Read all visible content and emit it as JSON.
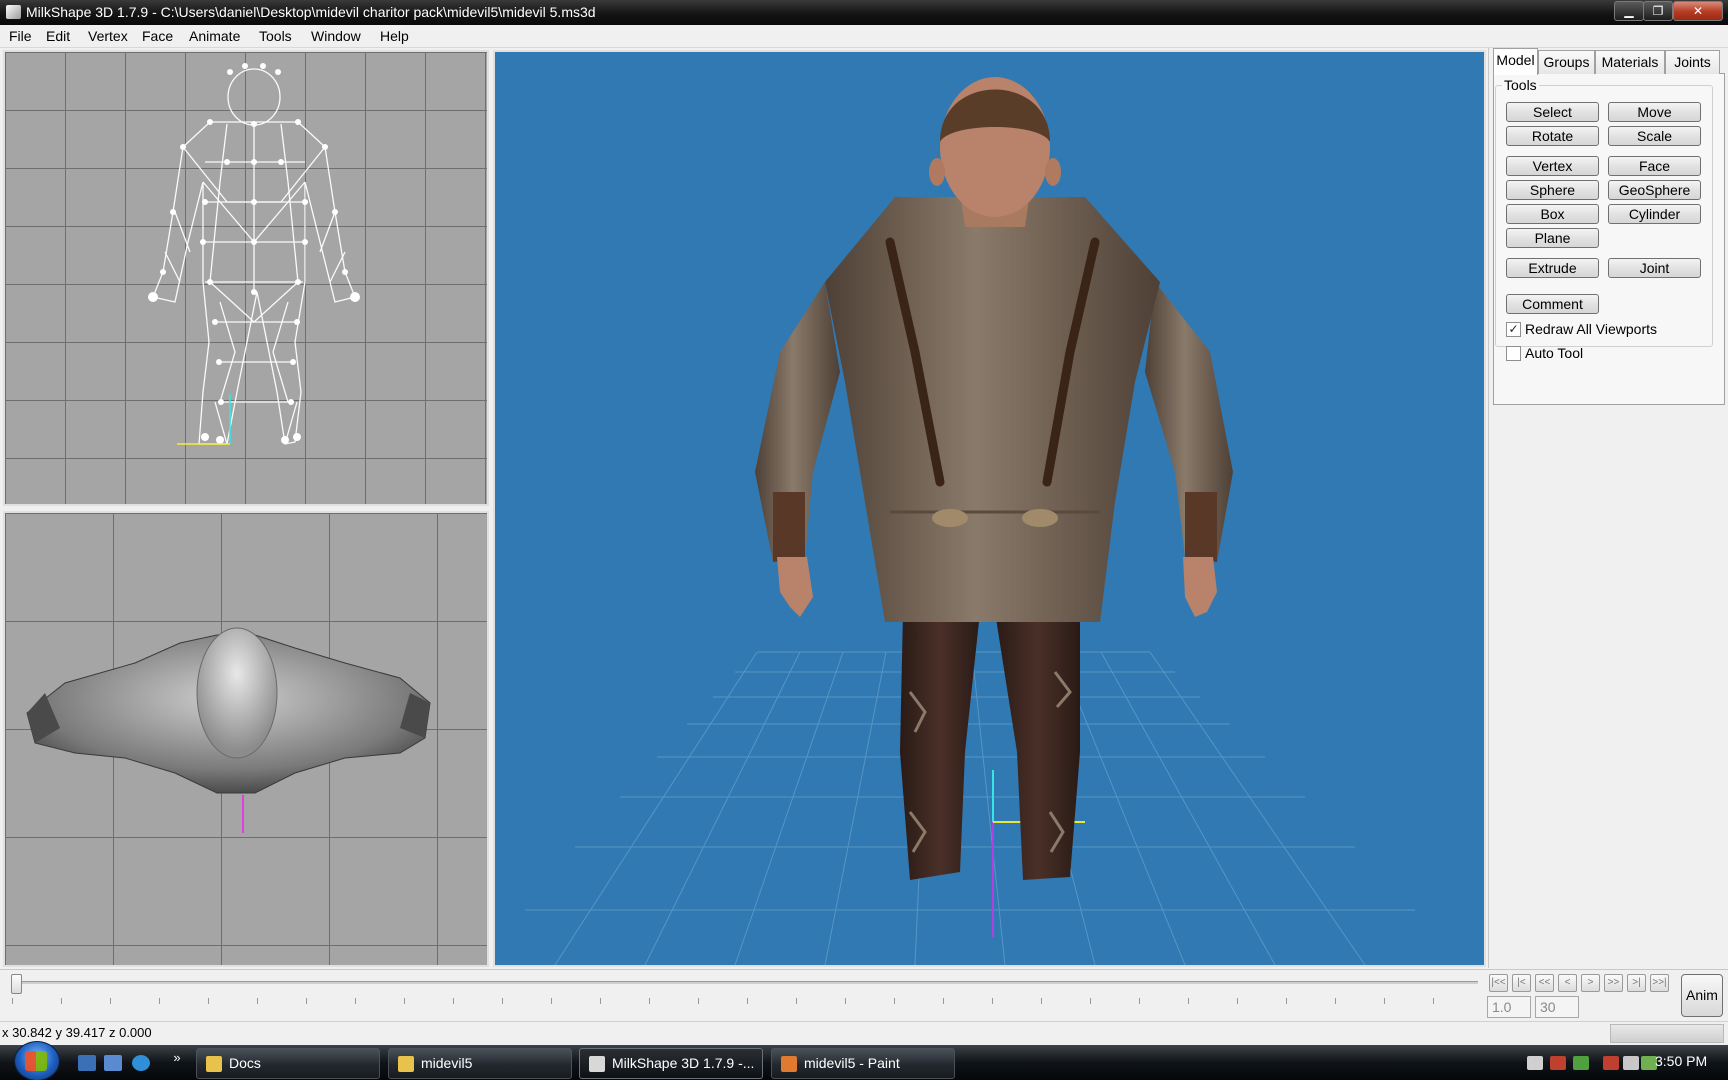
{
  "window": {
    "title": "MilkShape 3D 1.7.9 - C:\\Users\\daniel\\Desktop\\midevil charitor pack\\midevil5\\midevil 5.ms3d",
    "minimize_glyph": "▁",
    "maximize_glyph": "❐",
    "close_glyph": "✕"
  },
  "menu": [
    "File",
    "Edit",
    "Vertex",
    "Face",
    "Animate",
    "Tools",
    "Window",
    "Help"
  ],
  "panel": {
    "tabs": [
      "Model",
      "Groups",
      "Materials",
      "Joints"
    ],
    "active_tab": "Model",
    "group_label": "Tools",
    "buttons": [
      "Select",
      "Move",
      "Rotate",
      "Scale",
      "Vertex",
      "Face",
      "Sphere",
      "GeoSphere",
      "Box",
      "Cylinder",
      "Plane",
      "Extrude",
      "Joint",
      "Comment"
    ],
    "checkboxes": [
      {
        "label": "Redraw All Viewports",
        "checked": true,
        "mark": "✓"
      },
      {
        "label": "Auto Tool",
        "checked": false,
        "mark": ""
      }
    ]
  },
  "timeline": {
    "nav_buttons": [
      "|<<",
      "|<",
      "<<",
      "<",
      ">",
      ">>",
      ">|",
      ">>|"
    ],
    "frame_current": "1.0",
    "frame_total": "30",
    "anim_label": "Anim"
  },
  "status": {
    "coords": "x 30.842 y 39.417 z 0.000"
  },
  "taskbar": {
    "chevron": "»",
    "tasks": [
      {
        "label": "Docs",
        "icon": "folder-icon",
        "color": "#e8c24a"
      },
      {
        "label": "midevil5",
        "icon": "folder-icon",
        "color": "#e8c24a"
      },
      {
        "label": "MilkShape 3D 1.7.9 -...",
        "icon": "milkshape-icon",
        "color": "#d8d8d8"
      },
      {
        "label": "midevil5 - Paint",
        "icon": "paint-icon",
        "color": "#e07a30"
      }
    ],
    "clock": "3:50 PM"
  },
  "colors": {
    "viewport_3d_bg": "#3079b2",
    "viewport_2d_bg": "#a5a5a5",
    "shirt": "#6e5e50",
    "pants": "#3a2620",
    "skin": "#b8836a",
    "hair": "#5a3d28"
  }
}
